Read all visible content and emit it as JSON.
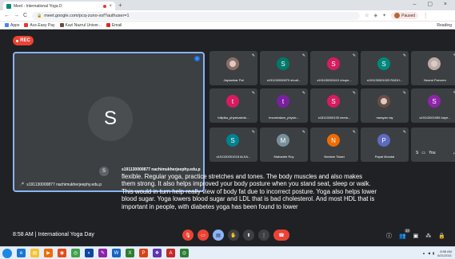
{
  "browser": {
    "tab_title": "Meet - International Yoga D",
    "tab_close": "×",
    "new_tab": "+",
    "window_controls": "– ▢ ×",
    "url": "meet.google.com/pcq-zuno-xof?authuser=1",
    "profile_label": "Paused",
    "bookmarks": [
      {
        "label": "Apps",
        "color": "#4285f4"
      },
      {
        "label": "Ace.Easy Pay",
        "color": "#e53935"
      },
      {
        "label": "Kazi Nazrul Univer...",
        "color": "#6d4c41"
      },
      {
        "label": "Email",
        "color": "#d93025"
      }
    ],
    "reading_list": "Reading"
  },
  "meet": {
    "rec_label": "REC",
    "main_participant": {
      "initial": "S",
      "name": "s191130000877 nachimukherjeephy.edu.p"
    },
    "tiles": [
      {
        "name": "Jaysankar Pal",
        "initial": "",
        "color": "#8d6e63",
        "photo": true
      },
      {
        "name": "s191130000870 shudi...",
        "initial": "S",
        "color": "#00796b"
      },
      {
        "name": "s191130001110 nhupe...",
        "initial": "S",
        "color": "#d81b60"
      },
      {
        "name": "s191130001020 RADH...",
        "initial": "S",
        "color": "#00897b"
      },
      {
        "name": "Nusrat Parveen",
        "initial": "",
        "color": "#bcaaa4",
        "photo": true
      },
      {
        "name": "tdlipika_physicaledu...",
        "initial": "t",
        "color": "#d81b60"
      },
      {
        "name": "tmoorkalam_physic...",
        "initial": "t",
        "color": "#7b1fa2"
      },
      {
        "name": "s18113000139 neela...",
        "initial": "S",
        "color": "#d81b60"
      },
      {
        "name": "narayan ray",
        "initial": "",
        "color": "#6d4c41",
        "photo": true
      },
      {
        "name": "s19113001056 kaye...",
        "initial": "S",
        "color": "#8e24aa"
      },
      {
        "name": "s191130001018 ALKA...",
        "initial": "S",
        "color": "#00838f"
      },
      {
        "name": "Mahadeb Roy",
        "initial": "M",
        "color": "#78909c"
      },
      {
        "name": "Neelam Tiwari",
        "initial": "N",
        "color": "#ef6c00"
      },
      {
        "name": "Papai Mondal",
        "initial": "P",
        "color": "#5c6bc0"
      }
    ],
    "you_label": "You",
    "caption": {
      "avatar_initial": "S",
      "speaker": "s191130000877 nachimukherjeephy.edu.p",
      "text": "flexible. Regular yoga, practice stretches and tones. The body muscles and also makes them strong. It also helps improved your body posture when you stand seat, sleep or walk. This would in turn help really view of body fat due to incorrect posture. Yoga also helps lower blood sugar. Yoga lowers blood sugar and LDL that is bad cholesterol. And most HDL that is important in people, with diabetes yoga has been found to lower"
    },
    "bottom": {
      "time": "8:58 AM",
      "separator": "|",
      "meeting_title": "International Yoga Day",
      "participants_count": "17"
    }
  },
  "taskbar": {
    "clock_time": "8:58 AM",
    "clock_date": "6/21/2021"
  }
}
